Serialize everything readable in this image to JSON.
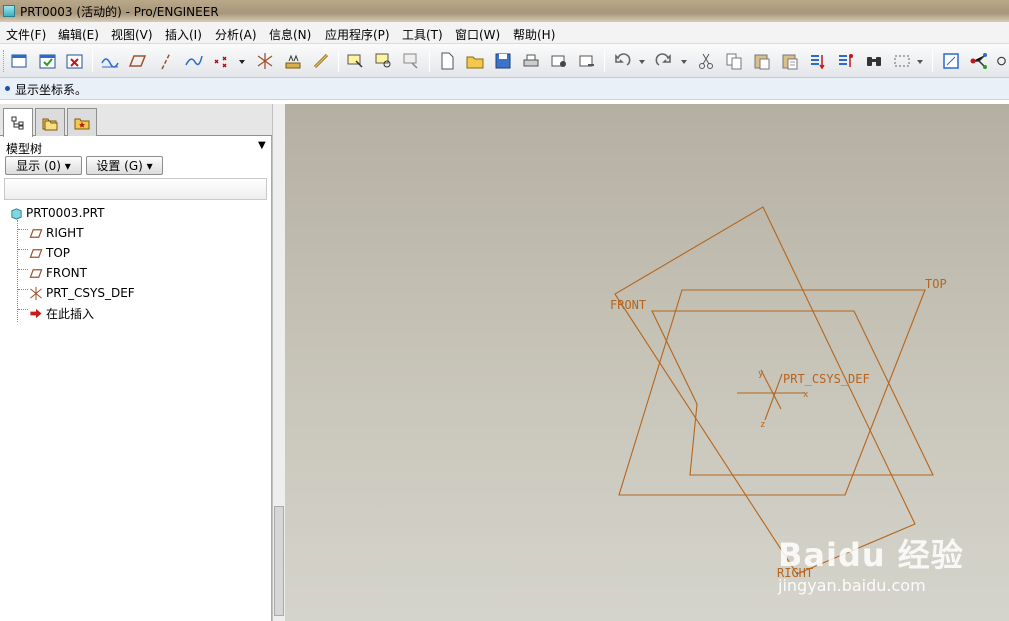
{
  "window": {
    "title": "PRT0003 (活动的) - Pro/ENGINEER"
  },
  "menu": [
    "文件(F)",
    "编辑(E)",
    "视图(V)",
    "插入(I)",
    "分析(A)",
    "信息(N)",
    "应用程序(P)",
    "工具(T)",
    "窗口(W)",
    "帮助(H)"
  ],
  "status": {
    "message": "显示坐标系。"
  },
  "panel": {
    "title": "模型树",
    "show_button": "显示 (0) ▾",
    "settings_button": "设置 (G) ▾"
  },
  "tree": {
    "root": "PRT0003.PRT",
    "items": [
      "RIGHT",
      "TOP",
      "FRONT",
      "PRT_CSYS_DEF",
      "在此插入"
    ]
  },
  "viewport": {
    "labels": {
      "front": "FRONT",
      "top": "TOP",
      "right": "RIGHT",
      "csys": "PRT_CSYS_DEF",
      "x": "x",
      "y": "y",
      "z": "z"
    },
    "datum_color": "#b5651d"
  },
  "watermark": {
    "logo": "Baidu 经验",
    "url": "jingyan.baidu.com"
  }
}
